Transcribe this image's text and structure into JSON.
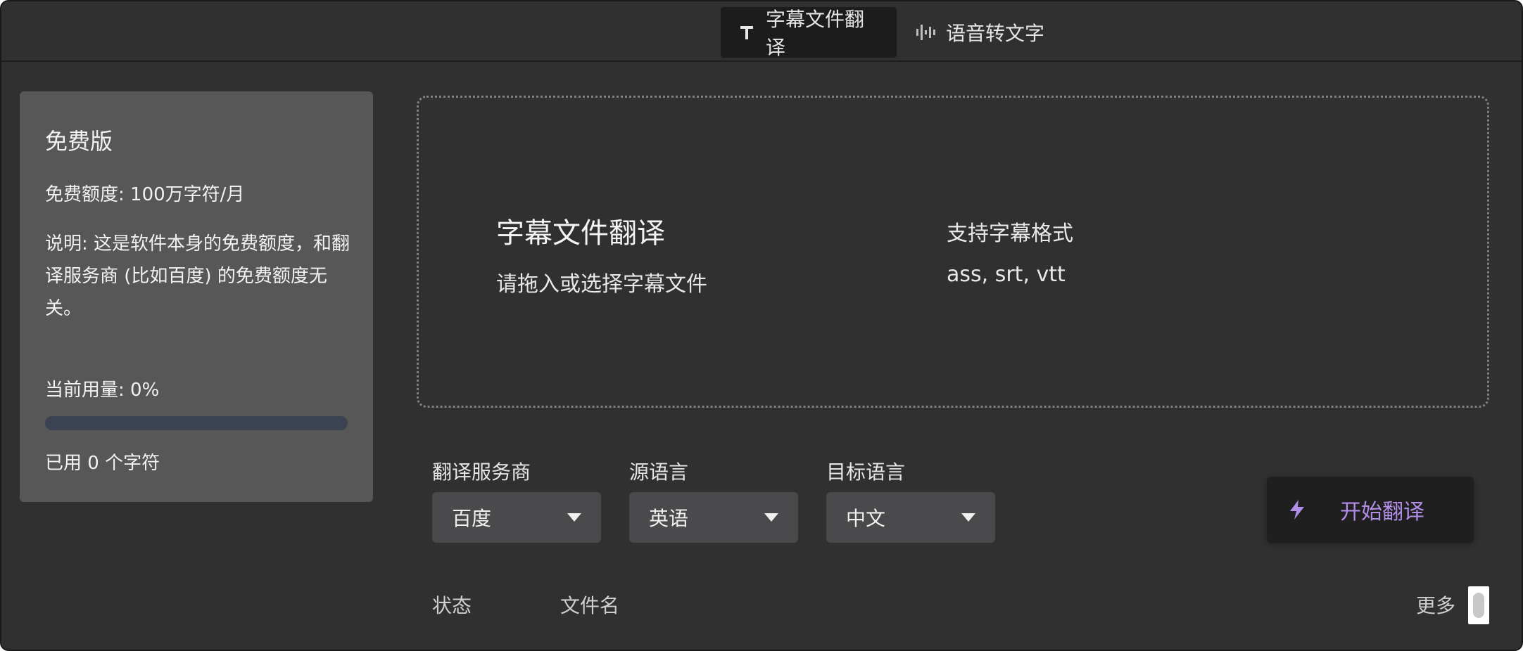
{
  "tabs": {
    "subtitle": "字幕文件翻译",
    "speech": "语音转文字"
  },
  "plan": {
    "title": "免费版",
    "quota": "免费额度: 100万字符/月",
    "note": "说明: 这是软件本身的免费额度，和翻译服务商 (比如百度) 的免费额度无关。",
    "usage": "当前用量: 0%",
    "usage_percent": 0,
    "used": "已用 0 个字符"
  },
  "dropzone": {
    "title": "字幕文件翻译",
    "hint": "请拖入或选择字幕文件",
    "formats_label": "支持字幕格式",
    "formats": "ass, srt, vtt"
  },
  "fields": {
    "provider_label": "翻译服务商",
    "provider_value": "百度",
    "source_label": "源语言",
    "source_value": "英语",
    "target_label": "目标语言",
    "target_value": "中文"
  },
  "actions": {
    "start": "开始翻译"
  },
  "table": {
    "status_header": "状态",
    "filename_header": "文件名",
    "more": "更多"
  },
  "colors": {
    "background": "#303030",
    "accent": "#b38ee8",
    "card": "#575757",
    "progress_track": "#3b4353"
  },
  "icons": {
    "subtitle_tab": "text-t-icon",
    "speech_tab": "waveform-icon",
    "start": "lightning-icon"
  }
}
